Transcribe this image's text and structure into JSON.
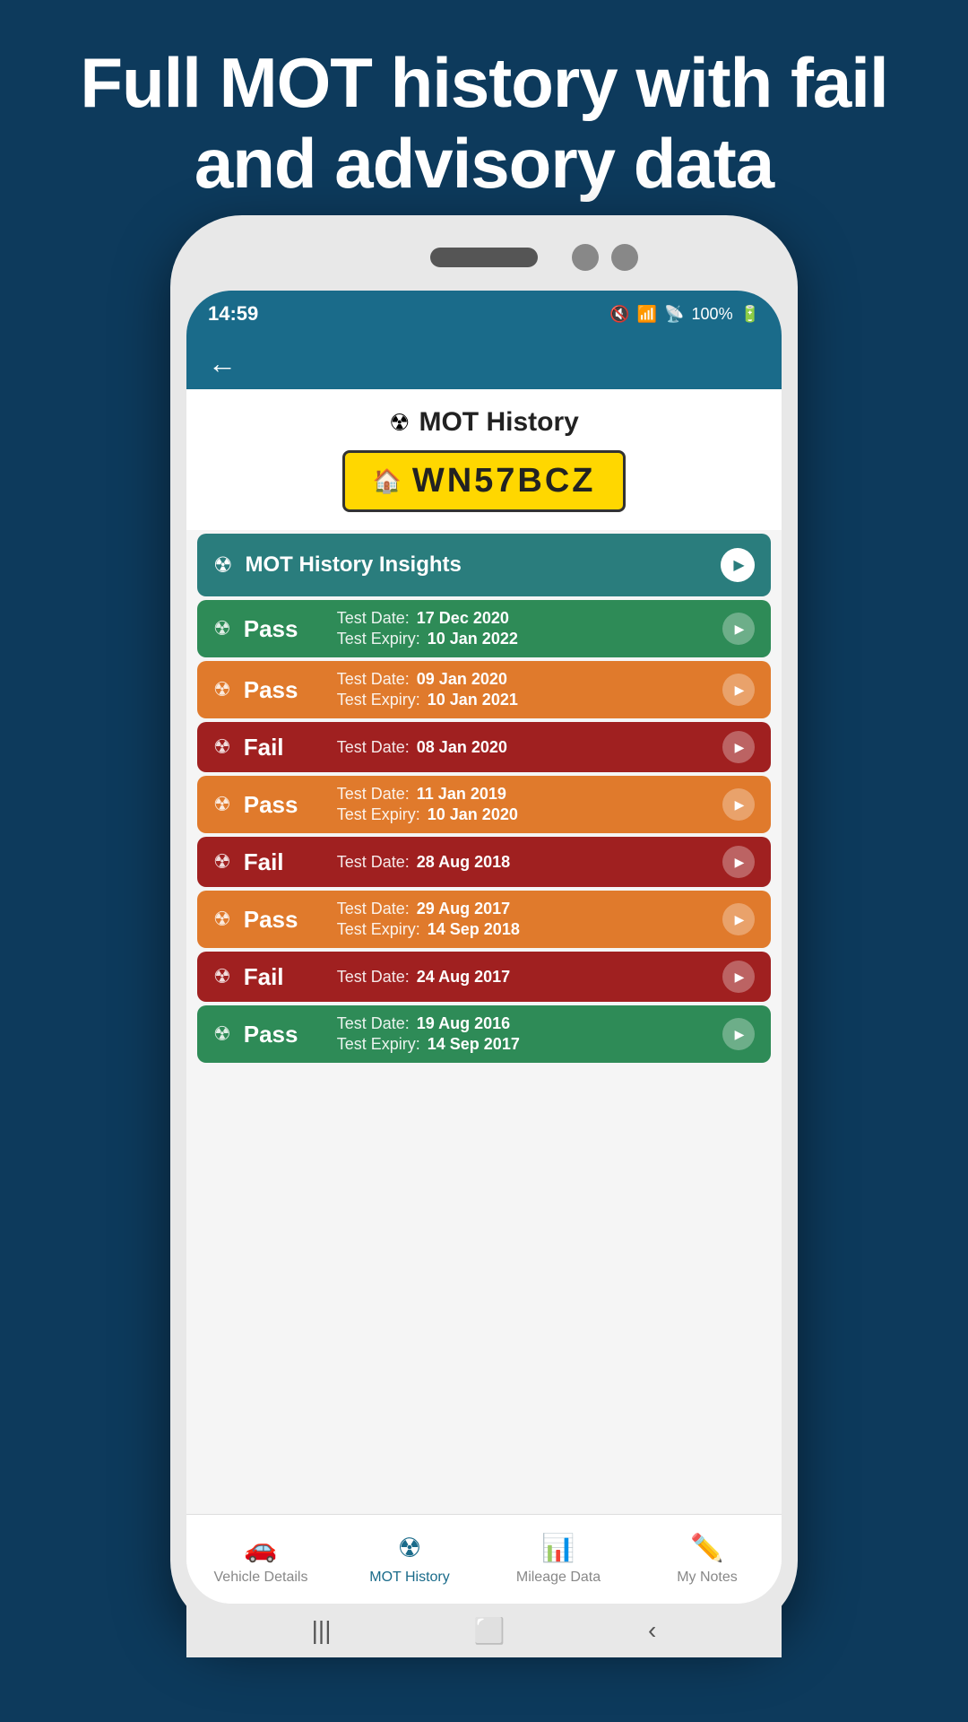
{
  "hero": {
    "title": "Full MOT history with fail and advisory data"
  },
  "status_bar": {
    "time": "14:59",
    "battery": "100%"
  },
  "header": {
    "title": "MOT History",
    "plate": "WN57BCZ"
  },
  "insights": {
    "label": "MOT History Insights"
  },
  "mot_records": [
    {
      "result": "Pass",
      "type": "pass-green",
      "test_date_label": "Test Date:",
      "test_date_value": "17 Dec 2020",
      "expiry_label": "Test Expiry:",
      "expiry_value": "10 Jan 2022",
      "has_expiry": true
    },
    {
      "result": "Pass",
      "type": "pass-orange",
      "test_date_label": "Test Date:",
      "test_date_value": "09 Jan 2020",
      "expiry_label": "Test Expiry:",
      "expiry_value": "10 Jan 2021",
      "has_expiry": true
    },
    {
      "result": "Fail",
      "type": "fail-red",
      "test_date_label": "Test Date:",
      "test_date_value": "08 Jan 2020",
      "expiry_label": "",
      "expiry_value": "",
      "has_expiry": false
    },
    {
      "result": "Pass",
      "type": "pass-orange",
      "test_date_label": "Test Date:",
      "test_date_value": "11 Jan 2019",
      "expiry_label": "Test Expiry:",
      "expiry_value": "10 Jan 2020",
      "has_expiry": true
    },
    {
      "result": "Fail",
      "type": "fail-red",
      "test_date_label": "Test Date:",
      "test_date_value": "28 Aug 2018",
      "expiry_label": "",
      "expiry_value": "",
      "has_expiry": false
    },
    {
      "result": "Pass",
      "type": "pass-orange",
      "test_date_label": "Test Date:",
      "test_date_value": "29 Aug 2017",
      "expiry_label": "Test Expiry:",
      "expiry_value": "14 Sep 2018",
      "has_expiry": true
    },
    {
      "result": "Fail",
      "type": "fail-red",
      "test_date_label": "Test Date:",
      "test_date_value": "24 Aug 2017",
      "expiry_label": "",
      "expiry_value": "",
      "has_expiry": false
    },
    {
      "result": "Pass",
      "type": "pass-green",
      "test_date_label": "Test Date:",
      "test_date_value": "19 Aug 2016",
      "expiry_label": "Test Expiry:",
      "expiry_value": "14 Sep 2017",
      "has_expiry": true
    }
  ],
  "tabs": [
    {
      "label": "Vehicle Details",
      "icon": "🚗",
      "active": false
    },
    {
      "label": "MOT History",
      "icon": "☢",
      "active": true
    },
    {
      "label": "Mileage Data",
      "icon": "📊",
      "active": false
    },
    {
      "label": "My Notes",
      "icon": "✏️",
      "active": false
    }
  ]
}
